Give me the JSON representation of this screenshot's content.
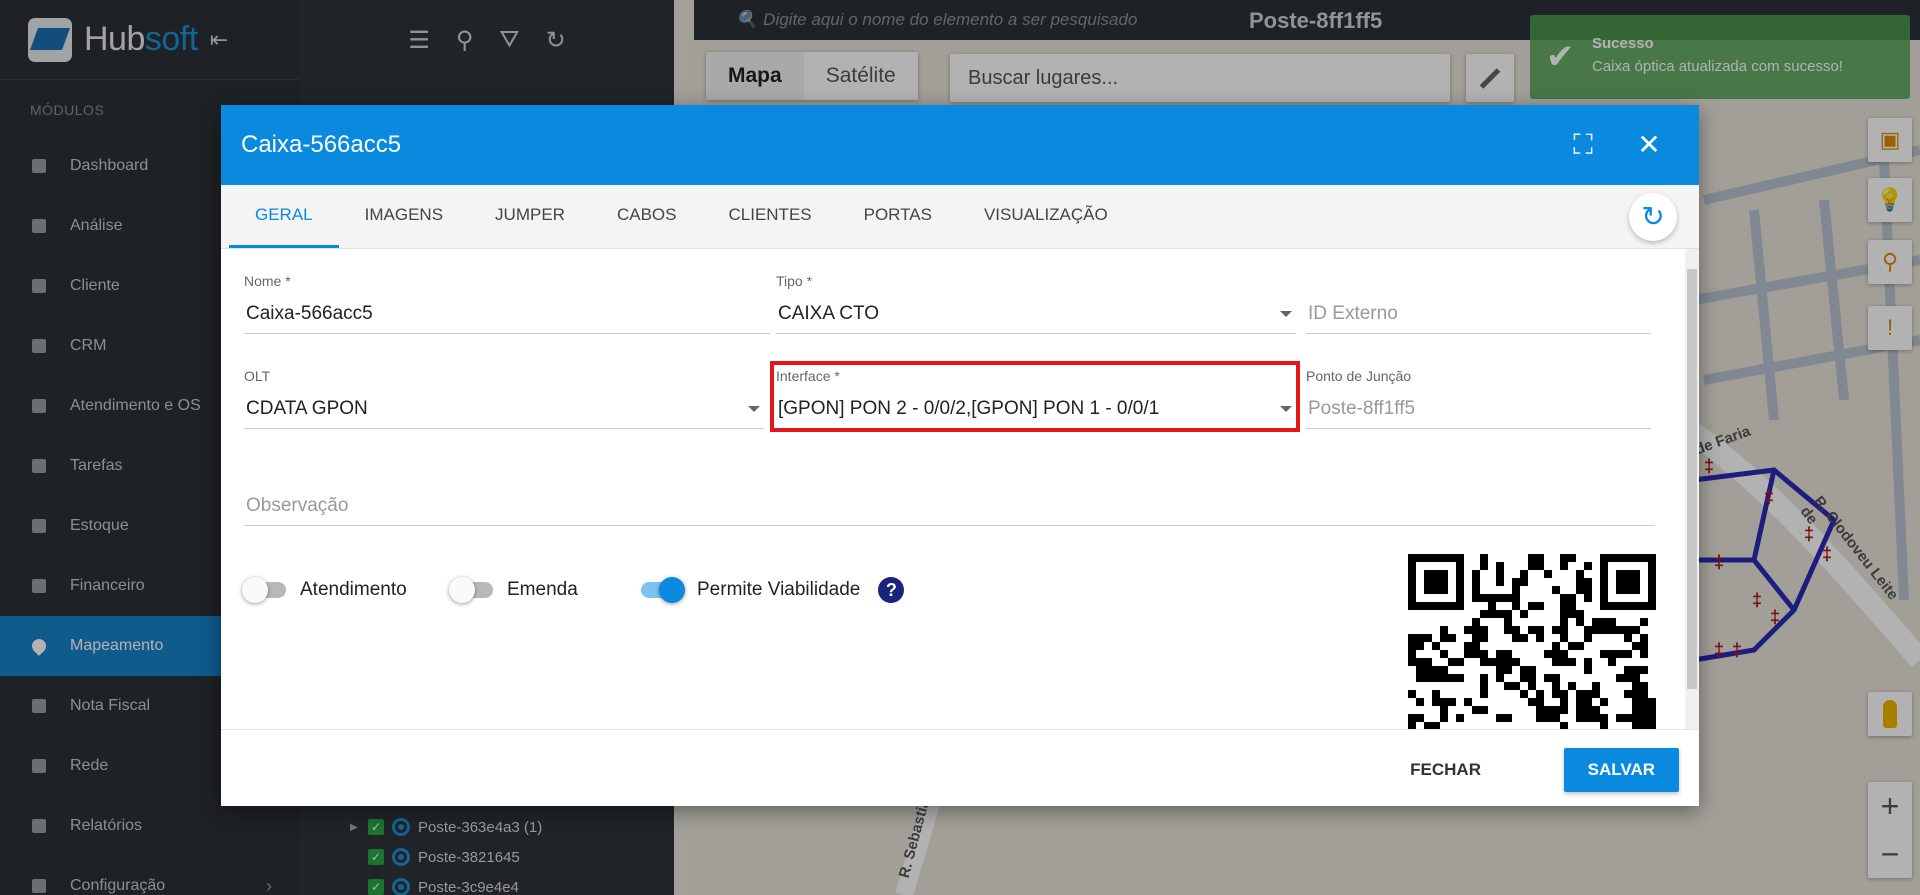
{
  "sidebar": {
    "logo_main": "Hub",
    "logo_accent": "soft",
    "modules_title": "MÓDULOS",
    "items": [
      {
        "label": "Dashboard",
        "icon": "dashboard-icon"
      },
      {
        "label": "Análise",
        "icon": "pie-chart-icon"
      },
      {
        "label": "Cliente",
        "icon": "contact-icon"
      },
      {
        "label": "CRM",
        "icon": "board-icon"
      },
      {
        "label": "Atendimento e OS",
        "icon": "calendar-clock-icon"
      },
      {
        "label": "Tarefas",
        "icon": "calendar-icon"
      },
      {
        "label": "Estoque",
        "icon": "box-icon"
      },
      {
        "label": "Financeiro",
        "icon": "money-icon"
      },
      {
        "label": "Mapeamento",
        "icon": "map-pin-icon",
        "active": true
      },
      {
        "label": "Nota Fiscal",
        "icon": "receipt-icon"
      },
      {
        "label": "Rede",
        "icon": "server-icon"
      },
      {
        "label": "Relatórios",
        "icon": "report-icon"
      },
      {
        "label": "Configuração",
        "icon": "gear-icon"
      }
    ]
  },
  "tree": {
    "items": [
      {
        "label": "Poste-363e4a3 (1)",
        "expandable": true
      },
      {
        "label": "Poste-3821645",
        "expandable": false
      },
      {
        "label": "Poste-3c9e4e4",
        "expandable": false
      }
    ]
  },
  "map": {
    "search_placeholder": "Digite aqui o nome do elemento a ser pesquisado",
    "title": "Poste-8ff1ff5",
    "map_label": "Mapa",
    "satellite_label": "Satélite",
    "places_placeholder": "Buscar lugares...",
    "streets": [
      "de Faria",
      "R. Clodoveu Leite de",
      "R. Sebastiã"
    ]
  },
  "toast": {
    "title": "Sucesso",
    "message": "Caixa óptica atualizada com sucesso!"
  },
  "modal": {
    "title": "Caixa-566acc5",
    "tabs": [
      "GERAL",
      "IMAGENS",
      "JUMPER",
      "CABOS",
      "CLIENTES",
      "PORTAS",
      "VISUALIZAÇÃO"
    ],
    "fields": {
      "nome_label": "Nome *",
      "nome_value": "Caixa-566acc5",
      "tipo_label": "Tipo *",
      "tipo_value": "CAIXA CTO",
      "id_externo_placeholder": "ID Externo",
      "olt_label": "OLT",
      "olt_value": "CDATA GPON",
      "interface_label": "Interface *",
      "interface_value": "[GPON] PON 2 - 0/0/2,[GPON] PON 1 - 0/0/1",
      "juncao_label": "Ponto de Junção",
      "juncao_value": "Poste-8ff1ff5",
      "observacao_placeholder": "Observação"
    },
    "toggles": {
      "atendimento": {
        "label": "Atendimento",
        "on": false
      },
      "emenda": {
        "label": "Emenda",
        "on": false
      },
      "viabilidade": {
        "label": "Permite Viabilidade",
        "on": true
      }
    },
    "help_label": "?",
    "close_label": "FECHAR",
    "save_label": "SALVAR"
  },
  "colors": {
    "primary": "#0a8adf",
    "sidebar_bg": "#2b3036",
    "active_menu": "#1583c9",
    "highlight": "#e8141c",
    "toast": "#51a351",
    "fiber": "#2a2ab8"
  }
}
